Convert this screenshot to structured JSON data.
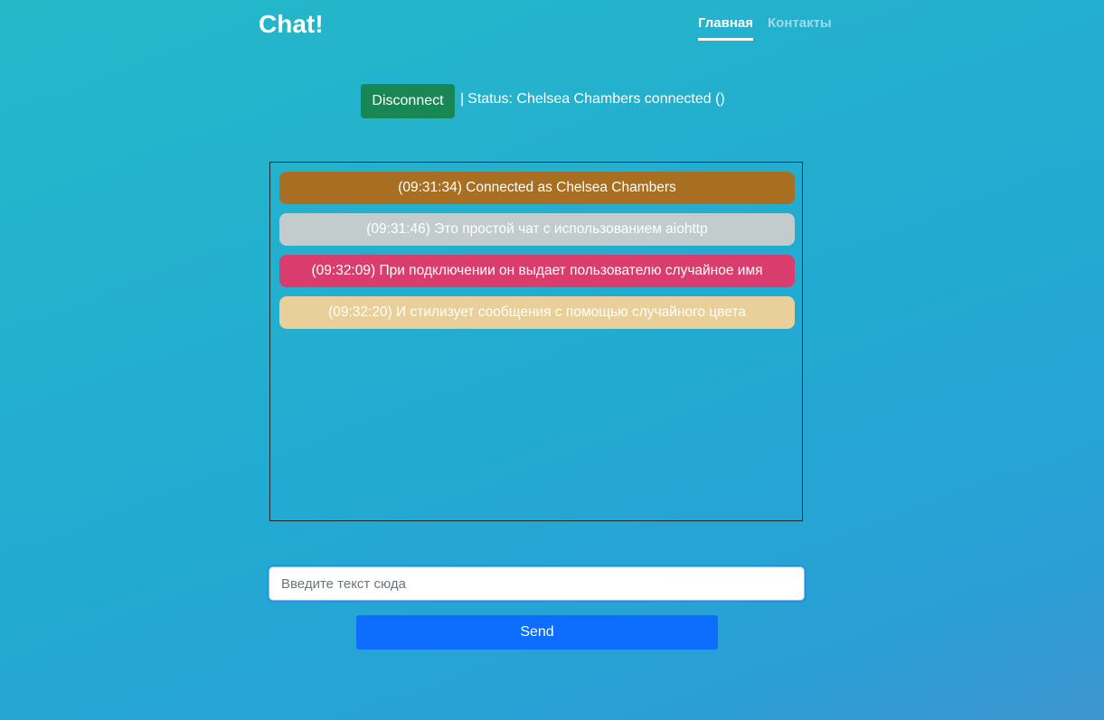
{
  "header": {
    "brand": "Chat!",
    "nav": [
      {
        "label": "Главная",
        "active": true
      },
      {
        "label": "Контакты",
        "active": false
      }
    ]
  },
  "status": {
    "button_label": "Disconnect",
    "separator": "|",
    "text": "Status: Chelsea Chambers connected ()"
  },
  "messages": [
    {
      "text": "(09:31:34) Connected as Chelsea Chambers",
      "color": "#a86f22"
    },
    {
      "text": "(09:31:46) Это простой чат с использованием aiohttp",
      "color": "#c2cccc"
    },
    {
      "text": "(09:32:09) При подключении он выдает пользователю случайное имя",
      "color": "#d93d6e"
    },
    {
      "text": "(09:32:20) И стилизует сообщения с помощью случайного цвета",
      "color": "#e9cf9a"
    }
  ],
  "composer": {
    "placeholder": "Введите текст сюда",
    "value": "",
    "send_label": "Send"
  },
  "colors": {
    "disconnect_button": "#198754",
    "send_button": "#0d6efd"
  }
}
